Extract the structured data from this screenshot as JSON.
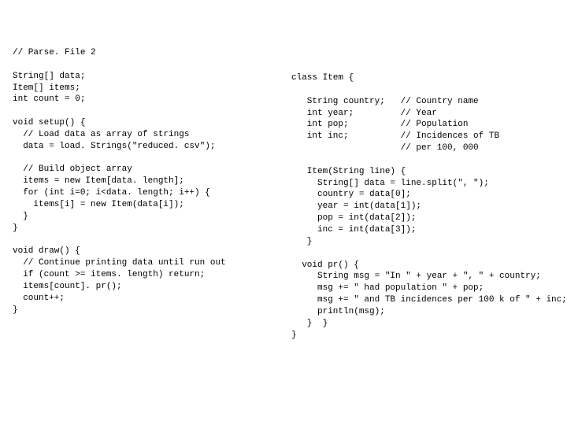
{
  "code": {
    "left": "// Parse. File 2\n\nString[] data;\nItem[] items;\nint count = 0;\n\nvoid setup() {\n  // Load data as array of strings\n  data = load. Strings(\"reduced. csv\");\n\n  // Build object array\n  items = new Item[data. length];\n  for (int i=0; i<data. length; i++) {\n    items[i] = new Item(data[i]);\n  }\n}\n\nvoid draw() {\n  // Continue printing data until run out\n  if (count >= items. length) return;\n  items[count]. pr();\n  count++;\n}",
    "right": "class Item {\n\n   String country;   // Country name\n   int year;         // Year\n   int pop;          // Population\n   int inc;          // Incidences of TB\n                     // per 100, 000\n\n   Item(String line) {\n     String[] data = line.split(\", \");\n     country = data[0];\n     year = int(data[1]);\n     pop = int(data[2]);\n     inc = int(data[3]);\n   }\n\n  void pr() {\n     String msg = \"In \" + year + \", \" + country;\n     msg += \" had population \" + pop;\n     msg += \" and TB incidences per 100 k of \" + inc;\n     println(msg);\n   }  }\n}"
  }
}
